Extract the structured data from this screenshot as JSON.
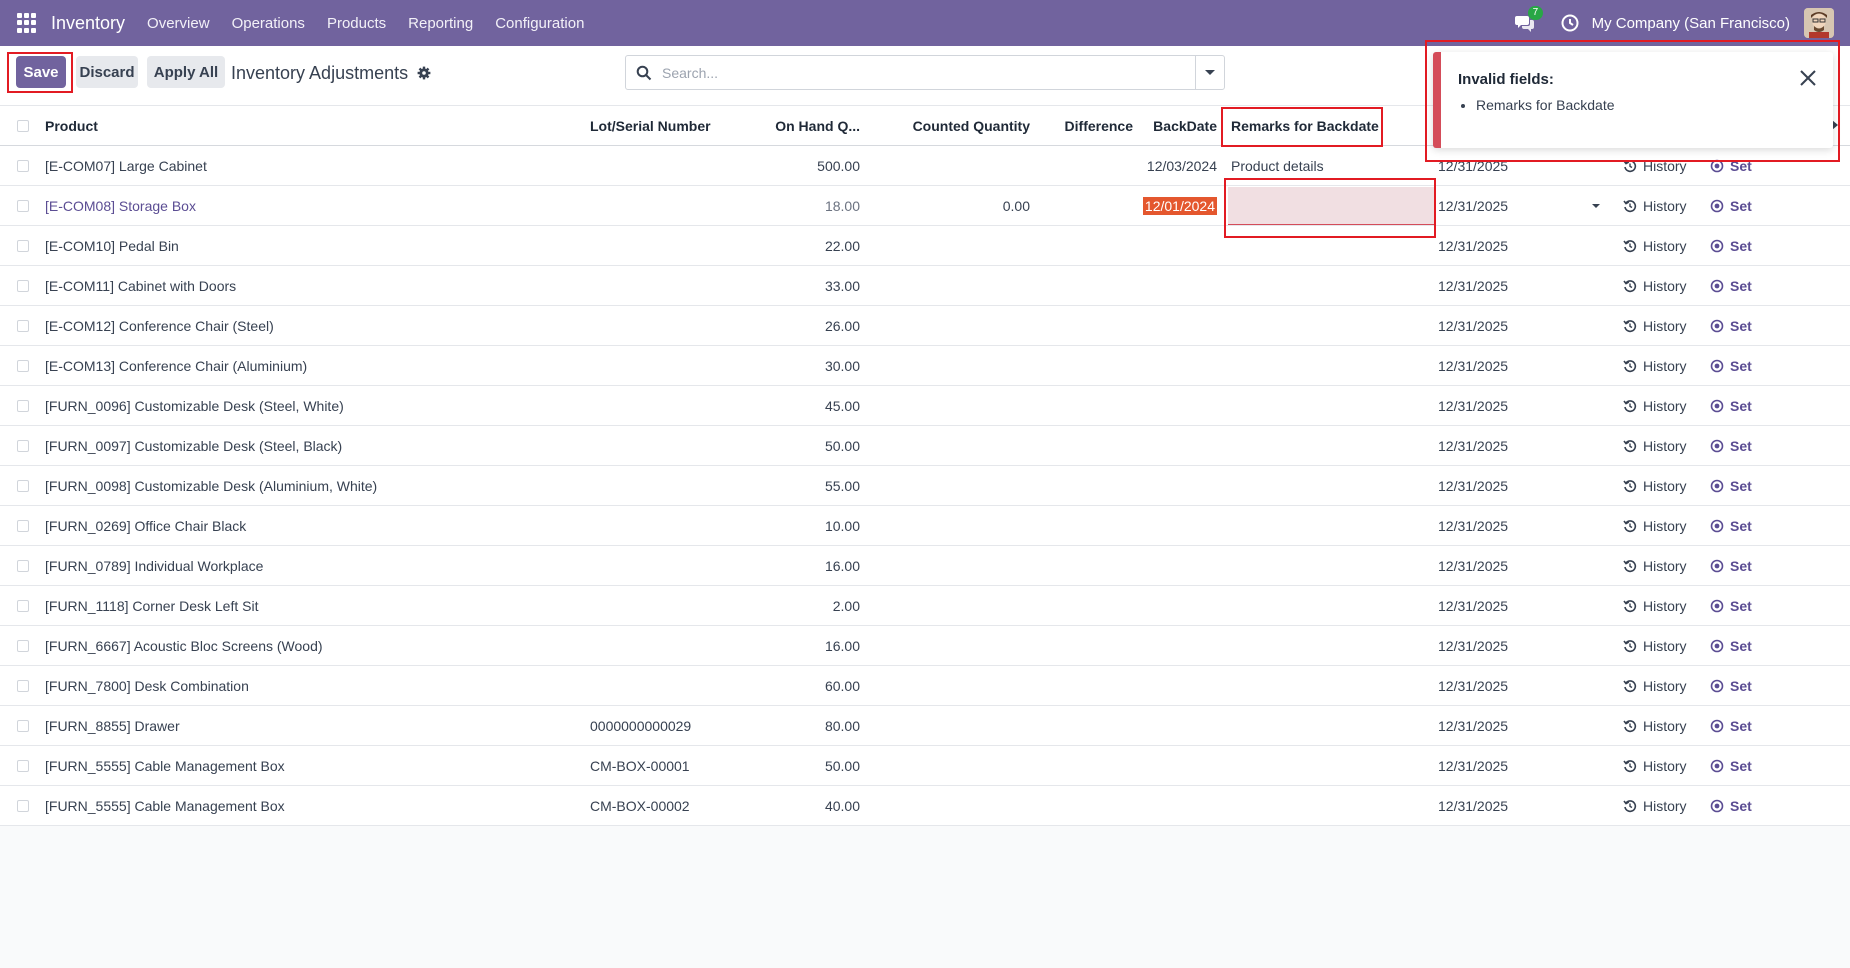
{
  "navbar": {
    "app_name": "Inventory",
    "menu": [
      "Overview",
      "Operations",
      "Products",
      "Reporting",
      "Configuration"
    ],
    "chat_count": "7",
    "company": "My Company (San Francisco)"
  },
  "control": {
    "save_label": "Save",
    "discard_label": "Discard",
    "apply_all_label": "Apply All",
    "title": "Inventory Adjustments",
    "search_placeholder": "Search..."
  },
  "table": {
    "headers": {
      "product": "Product",
      "lot": "Lot/Serial Number",
      "onhand": "On Hand Q...",
      "counted": "Counted Quantity",
      "difference": "Difference",
      "backdate": "BackDate",
      "remarks": "Remarks for Backdate"
    },
    "rows": [
      {
        "product": "[E-COM07] Large Cabinet",
        "lot": "",
        "onhand": "500.00",
        "counted": "",
        "backdate": "12/03/2024",
        "remarks": "Product details",
        "scheduled": "12/31/2025"
      },
      {
        "product": "[E-COM08] Storage Box",
        "lot": "",
        "onhand": "18.00",
        "counted": "0.00",
        "backdate": "12/01/2024",
        "remarks": "",
        "scheduled": "12/31/2025"
      },
      {
        "product": "[E-COM10] Pedal Bin",
        "lot": "",
        "onhand": "22.00",
        "counted": "",
        "backdate": "",
        "remarks": "",
        "scheduled": "12/31/2025"
      },
      {
        "product": "[E-COM11] Cabinet with Doors",
        "lot": "",
        "onhand": "33.00",
        "counted": "",
        "backdate": "",
        "remarks": "",
        "scheduled": "12/31/2025"
      },
      {
        "product": "[E-COM12] Conference Chair (Steel)",
        "lot": "",
        "onhand": "26.00",
        "counted": "",
        "backdate": "",
        "remarks": "",
        "scheduled": "12/31/2025"
      },
      {
        "product": "[E-COM13] Conference Chair (Aluminium)",
        "lot": "",
        "onhand": "30.00",
        "counted": "",
        "backdate": "",
        "remarks": "",
        "scheduled": "12/31/2025"
      },
      {
        "product": "[FURN_0096] Customizable Desk (Steel, White)",
        "lot": "",
        "onhand": "45.00",
        "counted": "",
        "backdate": "",
        "remarks": "",
        "scheduled": "12/31/2025"
      },
      {
        "product": "[FURN_0097] Customizable Desk (Steel, Black)",
        "lot": "",
        "onhand": "50.00",
        "counted": "",
        "backdate": "",
        "remarks": "",
        "scheduled": "12/31/2025"
      },
      {
        "product": "[FURN_0098] Customizable Desk (Aluminium, White)",
        "lot": "",
        "onhand": "55.00",
        "counted": "",
        "backdate": "",
        "remarks": "",
        "scheduled": "12/31/2025"
      },
      {
        "product": "[FURN_0269] Office Chair Black",
        "lot": "",
        "onhand": "10.00",
        "counted": "",
        "backdate": "",
        "remarks": "",
        "scheduled": "12/31/2025"
      },
      {
        "product": "[FURN_0789] Individual Workplace",
        "lot": "",
        "onhand": "16.00",
        "counted": "",
        "backdate": "",
        "remarks": "",
        "scheduled": "12/31/2025"
      },
      {
        "product": "[FURN_1118] Corner Desk Left Sit",
        "lot": "",
        "onhand": "2.00",
        "counted": "",
        "backdate": "",
        "remarks": "",
        "scheduled": "12/31/2025"
      },
      {
        "product": "[FURN_6667] Acoustic Bloc Screens (Wood)",
        "lot": "",
        "onhand": "16.00",
        "counted": "",
        "backdate": "",
        "remarks": "",
        "scheduled": "12/31/2025"
      },
      {
        "product": "[FURN_7800] Desk Combination",
        "lot": "",
        "onhand": "60.00",
        "counted": "",
        "backdate": "",
        "remarks": "",
        "scheduled": "12/31/2025"
      },
      {
        "product": "[FURN_8855] Drawer",
        "lot": "0000000000029",
        "onhand": "80.00",
        "counted": "",
        "backdate": "",
        "remarks": "",
        "scheduled": "12/31/2025"
      },
      {
        "product": "[FURN_5555] Cable Management Box",
        "lot": "CM-BOX-00001",
        "onhand": "50.00",
        "counted": "",
        "backdate": "",
        "remarks": "",
        "scheduled": "12/31/2025"
      },
      {
        "product": "[FURN_5555] Cable Management Box",
        "lot": "CM-BOX-00002",
        "onhand": "40.00",
        "counted": "",
        "backdate": "",
        "remarks": "",
        "scheduled": "12/31/2025"
      }
    ],
    "history_label": "History",
    "set_label": "Set"
  },
  "notification": {
    "title": "Invalid fields:",
    "items": [
      "Remarks for Backdate"
    ]
  },
  "colors": {
    "navbar": "#71639e",
    "primary": "#71639e",
    "error": "#d44c59",
    "annotation": "#e21b23",
    "backdate_highlight": "#e4572e"
  }
}
